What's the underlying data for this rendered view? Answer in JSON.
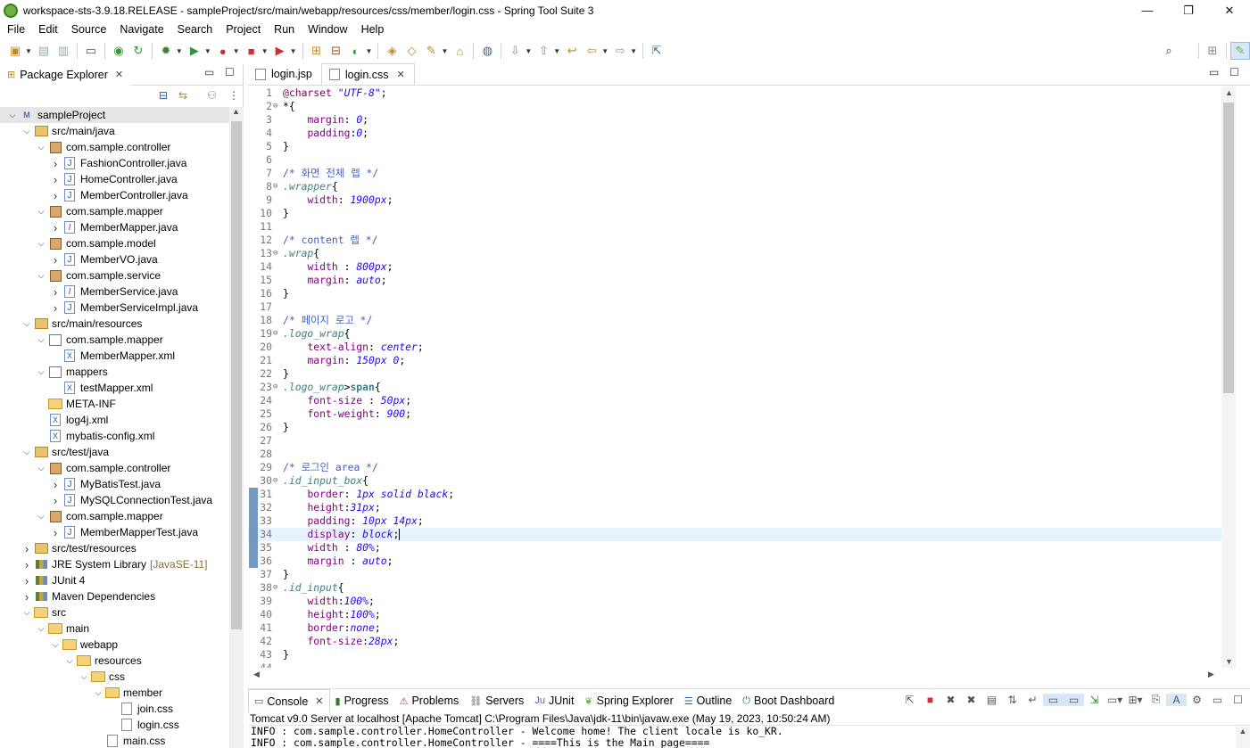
{
  "window": {
    "title": "workspace-sts-3.9.18.RELEASE - sampleProject/src/main/webapp/resources/css/member/login.css - Spring Tool Suite 3",
    "minimize": "—",
    "maximize": "❐",
    "close": "✕"
  },
  "menu": [
    "File",
    "Edit",
    "Source",
    "Navigate",
    "Search",
    "Project",
    "Run",
    "Window",
    "Help"
  ],
  "package_explorer": {
    "tab_label": "Package Explorer",
    "tree": [
      {
        "depth": 0,
        "twisty": "down",
        "icon": "project",
        "label": "sampleProject",
        "selected": true
      },
      {
        "depth": 1,
        "twisty": "down",
        "icon": "srcfolder",
        "label": "src/main/java"
      },
      {
        "depth": 2,
        "twisty": "down",
        "icon": "package",
        "label": "com.sample.controller"
      },
      {
        "depth": 3,
        "twisty": "right",
        "icon": "java",
        "label": "FashionController.java"
      },
      {
        "depth": 3,
        "twisty": "right",
        "icon": "java",
        "label": "HomeController.java"
      },
      {
        "depth": 3,
        "twisty": "right",
        "icon": "java",
        "label": "MemberController.java"
      },
      {
        "depth": 2,
        "twisty": "down",
        "icon": "package",
        "label": "com.sample.mapper"
      },
      {
        "depth": 3,
        "twisty": "right",
        "icon": "iface",
        "label": "MemberMapper.java"
      },
      {
        "depth": 2,
        "twisty": "down",
        "icon": "package",
        "label": "com.sample.model"
      },
      {
        "depth": 3,
        "twisty": "right",
        "icon": "java",
        "label": "MemberVO.java"
      },
      {
        "depth": 2,
        "twisty": "down",
        "icon": "package",
        "label": "com.sample.service"
      },
      {
        "depth": 3,
        "twisty": "right",
        "icon": "iface",
        "label": "MemberService.java"
      },
      {
        "depth": 3,
        "twisty": "right",
        "icon": "java",
        "label": "MemberServiceImpl.java"
      },
      {
        "depth": 1,
        "twisty": "down",
        "icon": "srcfolder",
        "label": "src/main/resources"
      },
      {
        "depth": 2,
        "twisty": "down",
        "icon": "respkg",
        "label": "com.sample.mapper"
      },
      {
        "depth": 3,
        "twisty": "",
        "icon": "xml",
        "label": "MemberMapper.xml"
      },
      {
        "depth": 2,
        "twisty": "down",
        "icon": "respkg",
        "label": "mappers"
      },
      {
        "depth": 3,
        "twisty": "",
        "icon": "xml",
        "label": "testMapper.xml"
      },
      {
        "depth": 2,
        "twisty": "",
        "icon": "folder",
        "label": "META-INF"
      },
      {
        "depth": 2,
        "twisty": "",
        "icon": "xml",
        "label": "log4j.xml"
      },
      {
        "depth": 2,
        "twisty": "",
        "icon": "xml",
        "label": "mybatis-config.xml"
      },
      {
        "depth": 1,
        "twisty": "down",
        "icon": "srcfolder",
        "label": "src/test/java"
      },
      {
        "depth": 2,
        "twisty": "down",
        "icon": "package",
        "label": "com.sample.controller"
      },
      {
        "depth": 3,
        "twisty": "right",
        "icon": "java",
        "label": "MyBatisTest.java"
      },
      {
        "depth": 3,
        "twisty": "right",
        "icon": "java",
        "label": "MySQLConnectionTest.java"
      },
      {
        "depth": 2,
        "twisty": "down",
        "icon": "package",
        "label": "com.sample.mapper"
      },
      {
        "depth": 3,
        "twisty": "right",
        "icon": "java",
        "label": "MemberMapperTest.java"
      },
      {
        "depth": 1,
        "twisty": "right",
        "icon": "srcfolder",
        "label": "src/test/resources"
      },
      {
        "depth": 1,
        "twisty": "right",
        "icon": "lib",
        "label": "JRE System Library",
        "suffix": "[JavaSE-11]"
      },
      {
        "depth": 1,
        "twisty": "right",
        "icon": "lib",
        "label": "JUnit 4"
      },
      {
        "depth": 1,
        "twisty": "right",
        "icon": "lib",
        "label": "Maven Dependencies"
      },
      {
        "depth": 1,
        "twisty": "down",
        "icon": "folder",
        "label": "src"
      },
      {
        "depth": 2,
        "twisty": "down",
        "icon": "folder",
        "label": "main"
      },
      {
        "depth": 3,
        "twisty": "down",
        "icon": "folder",
        "label": "webapp"
      },
      {
        "depth": 4,
        "twisty": "down",
        "icon": "folder",
        "label": "resources"
      },
      {
        "depth": 5,
        "twisty": "down",
        "icon": "folder",
        "label": "css"
      },
      {
        "depth": 6,
        "twisty": "down",
        "icon": "folder",
        "label": "member"
      },
      {
        "depth": 7,
        "twisty": "",
        "icon": "cssfile",
        "label": "join.css"
      },
      {
        "depth": 7,
        "twisty": "",
        "icon": "cssfile",
        "label": "login.css"
      },
      {
        "depth": 6,
        "twisty": "",
        "icon": "cssfile",
        "label": "main.css"
      }
    ]
  },
  "editor": {
    "tabs": [
      {
        "label": "login.jsp",
        "active": false
      },
      {
        "label": "login.css",
        "active": true
      }
    ],
    "lines": [
      {
        "n": "1",
        "fold": "",
        "chg": false,
        "tokens": [
          [
            "at",
            "@charset "
          ],
          [
            "val",
            "\"UTF-8\""
          ],
          [
            "pl",
            ";"
          ]
        ]
      },
      {
        "n": "2",
        "fold": "⊖",
        "chg": false,
        "tokens": [
          [
            "pl",
            "*{"
          ]
        ]
      },
      {
        "n": "3",
        "fold": "",
        "chg": false,
        "tokens": [
          [
            "pl",
            "    "
          ],
          [
            "prop",
            "margin"
          ],
          [
            "pl",
            ": "
          ],
          [
            "val",
            "0"
          ],
          [
            "pl",
            ";"
          ]
        ]
      },
      {
        "n": "4",
        "fold": "",
        "chg": false,
        "tokens": [
          [
            "pl",
            "    "
          ],
          [
            "prop",
            "padding"
          ],
          [
            "pl",
            ":"
          ],
          [
            "val",
            "0"
          ],
          [
            "pl",
            ";"
          ]
        ]
      },
      {
        "n": "5",
        "fold": "",
        "chg": false,
        "tokens": [
          [
            "pl",
            "}"
          ]
        ]
      },
      {
        "n": "6",
        "fold": "",
        "chg": false,
        "tokens": []
      },
      {
        "n": "7",
        "fold": "",
        "chg": false,
        "tokens": [
          [
            "com",
            "/* 화면 전체 렙 */"
          ]
        ]
      },
      {
        "n": "8",
        "fold": "⊖",
        "chg": false,
        "tokens": [
          [
            "sel",
            ".wrapper"
          ],
          [
            "pl",
            "{"
          ]
        ]
      },
      {
        "n": "9",
        "fold": "",
        "chg": false,
        "tokens": [
          [
            "pl",
            "    "
          ],
          [
            "prop",
            "width"
          ],
          [
            "pl",
            ": "
          ],
          [
            "val",
            "1900px"
          ],
          [
            "pl",
            ";"
          ]
        ]
      },
      {
        "n": "10",
        "fold": "",
        "chg": false,
        "tokens": [
          [
            "pl",
            "}"
          ]
        ]
      },
      {
        "n": "11",
        "fold": "",
        "chg": false,
        "tokens": []
      },
      {
        "n": "12",
        "fold": "",
        "chg": false,
        "tokens": [
          [
            "com",
            "/* content 렙 */"
          ]
        ]
      },
      {
        "n": "13",
        "fold": "⊖",
        "chg": false,
        "tokens": [
          [
            "sel",
            ".wrap"
          ],
          [
            "pl",
            "{"
          ]
        ]
      },
      {
        "n": "14",
        "fold": "",
        "chg": false,
        "tokens": [
          [
            "pl",
            "    "
          ],
          [
            "prop",
            "width"
          ],
          [
            "pl",
            " : "
          ],
          [
            "val",
            "800px"
          ],
          [
            "pl",
            ";"
          ]
        ]
      },
      {
        "n": "15",
        "fold": "",
        "chg": false,
        "tokens": [
          [
            "pl",
            "    "
          ],
          [
            "prop",
            "margin"
          ],
          [
            "pl",
            ": "
          ],
          [
            "val",
            "auto"
          ],
          [
            "pl",
            ";"
          ]
        ]
      },
      {
        "n": "16",
        "fold": "",
        "chg": false,
        "tokens": [
          [
            "pl",
            "}"
          ]
        ]
      },
      {
        "n": "17",
        "fold": "",
        "chg": false,
        "tokens": []
      },
      {
        "n": "18",
        "fold": "",
        "chg": false,
        "tokens": [
          [
            "com",
            "/* 페이지 로고 */"
          ]
        ]
      },
      {
        "n": "19",
        "fold": "⊖",
        "chg": false,
        "tokens": [
          [
            "sel",
            ".logo_wrap"
          ],
          [
            "pl",
            "{"
          ]
        ]
      },
      {
        "n": "20",
        "fold": "",
        "chg": false,
        "tokens": [
          [
            "pl",
            "    "
          ],
          [
            "prop",
            "text-align"
          ],
          [
            "pl",
            ": "
          ],
          [
            "val",
            "center"
          ],
          [
            "pl",
            ";"
          ]
        ]
      },
      {
        "n": "21",
        "fold": "",
        "chg": false,
        "tokens": [
          [
            "pl",
            "    "
          ],
          [
            "prop",
            "margin"
          ],
          [
            "pl",
            ": "
          ],
          [
            "val",
            "150px 0"
          ],
          [
            "pl",
            ";"
          ]
        ]
      },
      {
        "n": "22",
        "fold": "",
        "chg": false,
        "tokens": [
          [
            "pl",
            "}"
          ]
        ]
      },
      {
        "n": "23",
        "fold": "⊖",
        "chg": false,
        "tokens": [
          [
            "sel",
            ".logo_wrap"
          ],
          [
            "pl",
            ">"
          ],
          [
            "tag",
            "span"
          ],
          [
            "pl",
            "{"
          ]
        ]
      },
      {
        "n": "24",
        "fold": "",
        "chg": false,
        "tokens": [
          [
            "pl",
            "    "
          ],
          [
            "prop",
            "font-size"
          ],
          [
            "pl",
            " : "
          ],
          [
            "val",
            "50px"
          ],
          [
            "pl",
            ";"
          ]
        ]
      },
      {
        "n": "25",
        "fold": "",
        "chg": false,
        "tokens": [
          [
            "pl",
            "    "
          ],
          [
            "prop",
            "font-weight"
          ],
          [
            "pl",
            ": "
          ],
          [
            "val",
            "900"
          ],
          [
            "pl",
            ";"
          ]
        ]
      },
      {
        "n": "26",
        "fold": "",
        "chg": false,
        "tokens": [
          [
            "pl",
            "}"
          ]
        ]
      },
      {
        "n": "27",
        "fold": "",
        "chg": false,
        "tokens": []
      },
      {
        "n": "28",
        "fold": "",
        "chg": false,
        "tokens": []
      },
      {
        "n": "29",
        "fold": "",
        "chg": false,
        "tokens": [
          [
            "com",
            "/* 로그인 area */"
          ]
        ]
      },
      {
        "n": "30",
        "fold": "⊖",
        "chg": false,
        "tokens": [
          [
            "sel",
            ".id_input_box"
          ],
          [
            "pl",
            "{"
          ]
        ]
      },
      {
        "n": "31",
        "fold": "",
        "chg": true,
        "tokens": [
          [
            "pl",
            "    "
          ],
          [
            "prop",
            "border"
          ],
          [
            "pl",
            ": "
          ],
          [
            "val",
            "1px solid black"
          ],
          [
            "pl",
            ";"
          ]
        ]
      },
      {
        "n": "32",
        "fold": "",
        "chg": true,
        "tokens": [
          [
            "pl",
            "    "
          ],
          [
            "prop",
            "height"
          ],
          [
            "pl",
            ":"
          ],
          [
            "val",
            "31px"
          ],
          [
            "pl",
            ";"
          ]
        ]
      },
      {
        "n": "33",
        "fold": "",
        "chg": true,
        "tokens": [
          [
            "pl",
            "    "
          ],
          [
            "prop",
            "padding"
          ],
          [
            "pl",
            ": "
          ],
          [
            "val",
            "10px 14px"
          ],
          [
            "pl",
            ";"
          ]
        ]
      },
      {
        "n": "34",
        "fold": "",
        "chg": true,
        "current": true,
        "tokens": [
          [
            "pl",
            "    "
          ],
          [
            "prop",
            "display"
          ],
          [
            "pl",
            ": "
          ],
          [
            "val",
            "block"
          ],
          [
            "pl",
            ";"
          ]
        ]
      },
      {
        "n": "35",
        "fold": "",
        "chg": true,
        "tokens": [
          [
            "pl",
            "    "
          ],
          [
            "prop",
            "width"
          ],
          [
            "pl",
            " : "
          ],
          [
            "val",
            "80%"
          ],
          [
            "pl",
            ";"
          ]
        ]
      },
      {
        "n": "36",
        "fold": "",
        "chg": true,
        "tokens": [
          [
            "pl",
            "    "
          ],
          [
            "prop",
            "margin"
          ],
          [
            "pl",
            " : "
          ],
          [
            "val",
            "auto"
          ],
          [
            "pl",
            ";"
          ]
        ]
      },
      {
        "n": "37",
        "fold": "",
        "chg": false,
        "tokens": [
          [
            "pl",
            "}"
          ]
        ]
      },
      {
        "n": "38",
        "fold": "⊖",
        "chg": false,
        "tokens": [
          [
            "sel",
            ".id_input"
          ],
          [
            "pl",
            "{"
          ]
        ]
      },
      {
        "n": "39",
        "fold": "",
        "chg": false,
        "tokens": [
          [
            "pl",
            "    "
          ],
          [
            "prop",
            "width"
          ],
          [
            "pl",
            ":"
          ],
          [
            "val",
            "100%"
          ],
          [
            "pl",
            ";"
          ]
        ]
      },
      {
        "n": "40",
        "fold": "",
        "chg": false,
        "tokens": [
          [
            "pl",
            "    "
          ],
          [
            "prop",
            "height"
          ],
          [
            "pl",
            ":"
          ],
          [
            "val",
            "100%"
          ],
          [
            "pl",
            ";"
          ]
        ]
      },
      {
        "n": "41",
        "fold": "",
        "chg": false,
        "tokens": [
          [
            "pl",
            "    "
          ],
          [
            "prop",
            "border"
          ],
          [
            "pl",
            ":"
          ],
          [
            "val",
            "none"
          ],
          [
            "pl",
            ";"
          ]
        ]
      },
      {
        "n": "42",
        "fold": "",
        "chg": false,
        "tokens": [
          [
            "pl",
            "    "
          ],
          [
            "prop",
            "font-size"
          ],
          [
            "pl",
            ":"
          ],
          [
            "val",
            "28px"
          ],
          [
            "pl",
            ";"
          ]
        ]
      },
      {
        "n": "43",
        "fold": "",
        "chg": false,
        "tokens": [
          [
            "pl",
            "}"
          ]
        ]
      },
      {
        "n": "44",
        "fold": "",
        "chg": false,
        "tokens": []
      }
    ]
  },
  "bottom": {
    "tabs": [
      {
        "label": "Console",
        "icon": "console-icon",
        "glyph": "▭",
        "color": "#2c5aa0",
        "active": true,
        "closable": true
      },
      {
        "label": "Progress",
        "icon": "progress-icon",
        "glyph": "▮",
        "color": "#2c7a2c"
      },
      {
        "label": "Problems",
        "icon": "problems-icon",
        "glyph": "⚠",
        "color": "#b04a2a"
      },
      {
        "label": "Servers",
        "icon": "servers-icon",
        "glyph": "⛓",
        "color": "#555"
      },
      {
        "label": "JUnit",
        "icon": "junit-icon",
        "glyph": "Ju",
        "color": "#3b6aa8"
      },
      {
        "label": "Spring Explorer",
        "icon": "spring-explorer-icon",
        "glyph": "❦",
        "color": "#6db33f"
      },
      {
        "label": "Outline",
        "icon": "outline-icon",
        "glyph": "☰",
        "color": "#2c5aa0"
      },
      {
        "label": "Boot Dashboard",
        "icon": "boot-dashboard-icon",
        "glyph": "⏻",
        "color": "#2c7a2c"
      }
    ],
    "status": "Tomcat v9.0 Server at localhost [Apache Tomcat] C:\\Program Files\\Java\\jdk-11\\bin\\javaw.exe  (May 19, 2023, 10:50:24 AM)",
    "lines": [
      "INFO : com.sample.controller.HomeController - Welcome home! The client locale is ko_KR.",
      "INFO : com.sample.controller.HomeController - ====This is the Main page===="
    ]
  },
  "colors": {
    "accent": "#5c88b8",
    "current_line": "#e8f2fe",
    "comment": "#3f5fbf",
    "property": "#7f007f",
    "value": "#2a00ff"
  }
}
